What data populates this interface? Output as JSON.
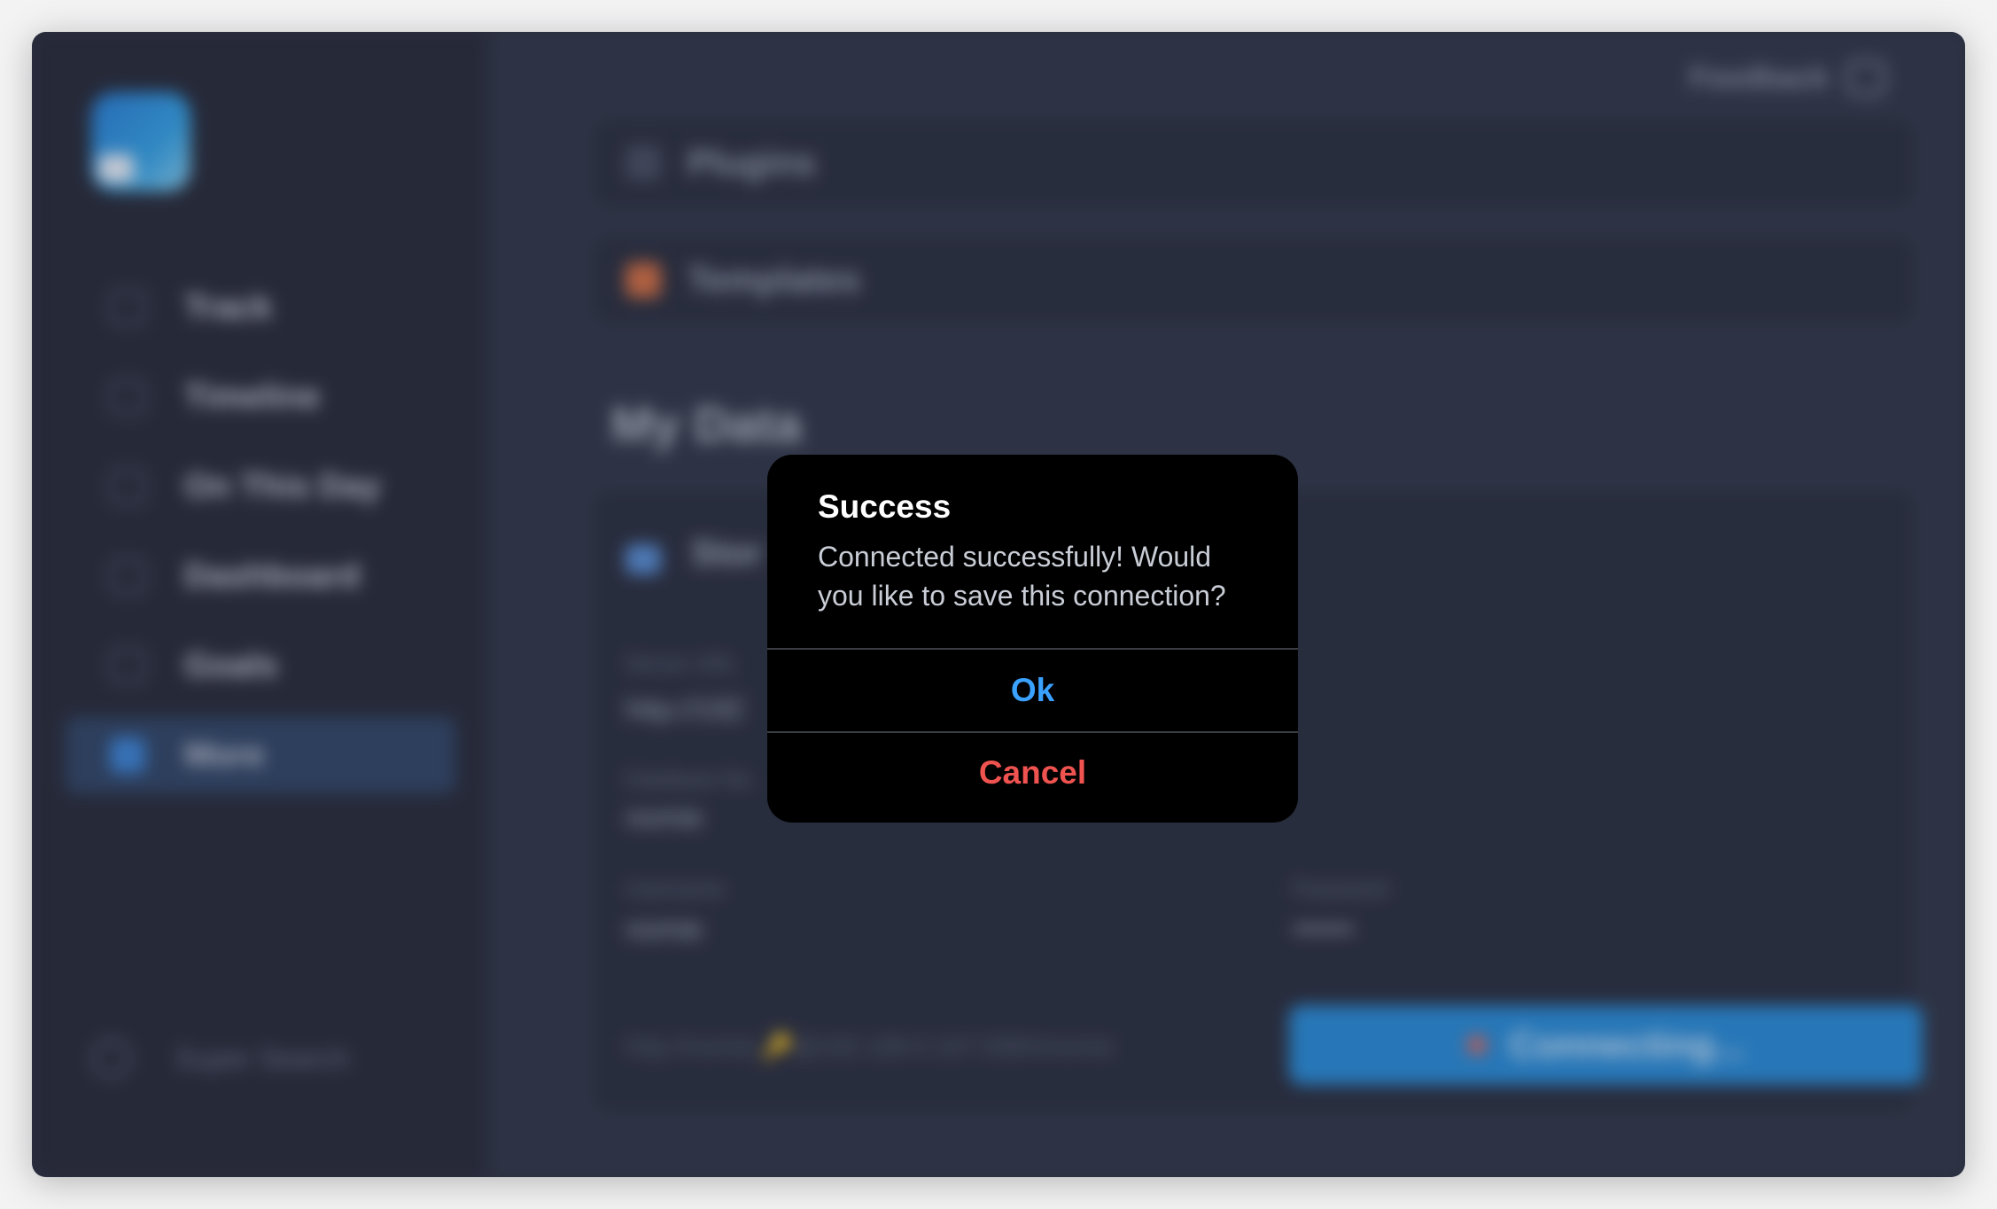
{
  "background_app": {
    "sidebar": {
      "items": [
        {
          "label": "Track",
          "icon": "track-icon",
          "active": false
        },
        {
          "label": "Timeline",
          "icon": "timeline-icon",
          "active": false
        },
        {
          "label": "On This Day",
          "icon": "calendar-icon",
          "active": false
        },
        {
          "label": "Dashboard",
          "icon": "dashboard-icon",
          "active": false
        },
        {
          "label": "Goals",
          "icon": "goals-icon",
          "active": false
        },
        {
          "label": "More",
          "icon": "more-icon",
          "active": true
        }
      ],
      "super_search": "Super Search"
    },
    "header": {
      "feedback": "Feedback"
    },
    "cards": {
      "plugins": "Plugins",
      "templates": "Templates"
    },
    "section_title": "My Data",
    "database": {
      "title": "Stor",
      "server_url_label": "Server URL",
      "server_url_value": "http://192",
      "database_name_label": "Database Na",
      "database_name_value": "nomie",
      "username_label": "Username",
      "username_value": "nomie",
      "password_label": "Password",
      "password_value": "••••••",
      "footer_url": "http://nomie:🔑@192.168.0.107:5984/nomie",
      "connect_button": "Connecting..."
    }
  },
  "alert": {
    "title": "Success",
    "message": "Connected successfully! Would you like to save this connection?",
    "ok_label": "Ok",
    "cancel_label": "Cancel"
  },
  "colors": {
    "window_bg": "#2f3446",
    "sidebar_bg": "#2a2e3e",
    "alert_bg": "#000000",
    "ok_color": "#3aa1ff",
    "cancel_color": "#ef5350",
    "accent": "#2b8cd8"
  }
}
